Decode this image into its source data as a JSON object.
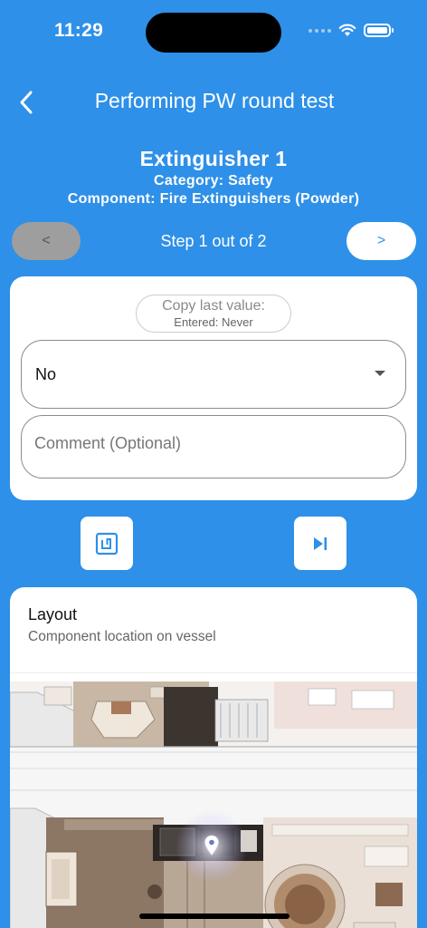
{
  "status_bar": {
    "time": "11:29"
  },
  "header": {
    "title": "Performing PW round test"
  },
  "item": {
    "name": "Extinguisher 1",
    "category": "Category: Safety",
    "component": "Component: Fire Extinguishers (Powder)"
  },
  "step_nav": {
    "prev_label": "<",
    "step_text": "Step 1 out of 2",
    "next_label": ">"
  },
  "form": {
    "copy_title": "Copy last value:",
    "copy_sub": "Entered: Never",
    "selected_value": "No",
    "comment_placeholder": "Comment (Optional)",
    "comment_value": ""
  },
  "layout": {
    "title": "Layout",
    "subtitle": "Component location on vessel"
  },
  "colors": {
    "background": "#2e90e8",
    "card": "#ffffff",
    "disabled_button": "#9e9e9e"
  },
  "icons": [
    "back-chevron-icon",
    "nfc-tag-icon",
    "skip-next-icon",
    "location-pin-icon",
    "wifi-icon",
    "battery-icon"
  ]
}
